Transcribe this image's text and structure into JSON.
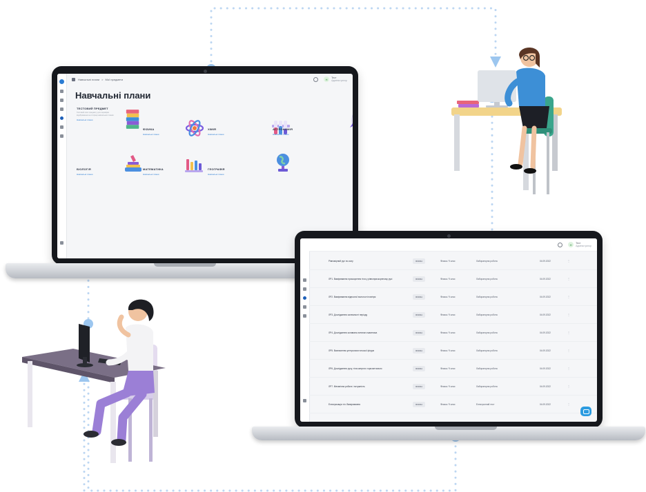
{
  "colors": {
    "accent": "#2b7cd3",
    "connector": "#bcd6f2",
    "connector_dot": "#9cc6ef",
    "fab": "#2b9be0"
  },
  "screen1": {
    "breadcrumb": [
      "Навчальні плани",
      "Мої предмети"
    ],
    "breadcrumb_separator": ">",
    "user": {
      "avatar_initial": "Н",
      "name": "Тест",
      "role": "Адміністратор"
    },
    "page_title": "Навчальні плани",
    "subjects": [
      {
        "name": "ТЕСТОВИЙ ПРЕДМЕТ",
        "desc": "Тестовий опис предмету для перевірки відображення на сторінці навчальних планів",
        "link": "Навчальні плани",
        "art": "books-icon"
      },
      {
        "name": "ФІЗИКА",
        "link": "Навчальні плани",
        "art": "atom-icon"
      },
      {
        "name": "ХІМІЯ",
        "link": "Навчальні плани",
        "art": "test-tubes-icon"
      },
      {
        "name": "АСТРОНОМІЯ",
        "link": "Навчальні плани",
        "art": "rocket-icon"
      },
      {
        "name": "БІОЛОГІЯ",
        "link": "Навчальні плани",
        "art": "microscope-icon"
      },
      {
        "name": "МАТЕМАТИКА",
        "link": "Навчальні плани",
        "art": "rocket-chart-icon"
      },
      {
        "name": "ГЕОГРАФІЯ",
        "link": "Навчальні плани",
        "art": "globe-icon"
      }
    ]
  },
  "screen2": {
    "user": {
      "name": "Тест",
      "role": "Адміністратор"
    },
    "rows": [
      {
        "title": "Рівномірний рух по колу",
        "tag": "ФІЗИКА",
        "grade": "Фізика / 9 клас",
        "type": "Лабораторна робота",
        "date": "04.09.2022"
      },
      {
        "title": "ЛР1. Вимірювання прискорення тіла у рівноприскореному русі",
        "tag": "ФІЗИКА",
        "grade": "Фізика / 9 клас",
        "type": "Лабораторна робота",
        "date": "04.09.2022"
      },
      {
        "title": "ЛР2. Вимірювання відносної вологості повітря",
        "tag": "ФІЗИКА",
        "grade": "Фізика / 9 клас",
        "type": "Лабораторна робота",
        "date": "04.09.2022"
      },
      {
        "title": "ЛР3. Дослідження залежності періоду",
        "tag": "ФІЗИКА",
        "grade": "Фізика / 9 клас",
        "type": "Лабораторна робота",
        "date": "04.09.2022"
      },
      {
        "title": "ЛР4. Дослідження коливань нитяного маятника",
        "tag": "ФІЗИКА",
        "grade": "Фізика / 9 клас",
        "type": "Лабораторна робота",
        "date": "04.09.2022"
      },
      {
        "title": "ЛР5. Визначення центра ваги плоскої фігури",
        "tag": "ФІЗИКА",
        "grade": "Фізика / 9 клас",
        "type": "Лабораторна робота",
        "date": "04.09.2022"
      },
      {
        "title": "ЛР6. Дослідження руху, тілa кинутого горизонтально",
        "tag": "ФІЗИКА",
        "grade": "Фізика / 9 клас",
        "type": "Лабораторна робота",
        "date": "04.09.2022"
      },
      {
        "title": "ЛР7. Механічна робота і потужність",
        "tag": "ФІЗИКА",
        "grade": "Фізика / 9 клас",
        "type": "Лабораторна робота",
        "date": "04.09.2022"
      },
      {
        "title": "Електризація тіл. Вимірювання",
        "tag": "ФІЗИКА",
        "grade": "Фізика / 9 клас",
        "type": "Електронний тест",
        "date": "04.09.2022"
      }
    ]
  }
}
